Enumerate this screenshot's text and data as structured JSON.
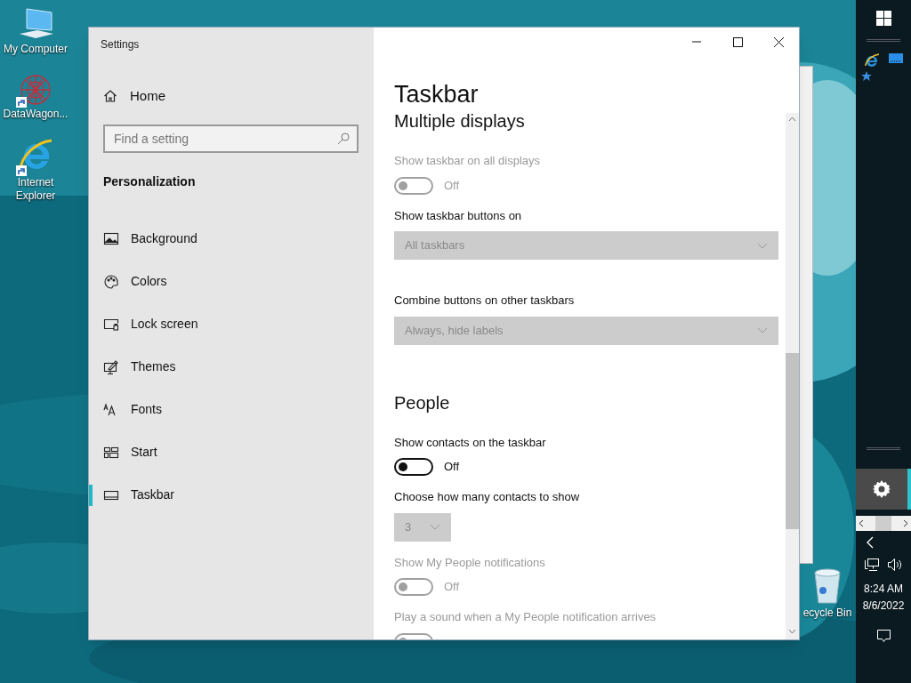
{
  "desktop_icons": [
    {
      "label": "My Computer",
      "kind": "computer",
      "shortcut": false
    },
    {
      "label": "DataWagon...",
      "kind": "network",
      "shortcut": true
    },
    {
      "label": "Internet Explorer",
      "kind": "browser",
      "shortcut": true
    }
  ],
  "recycle_bin": {
    "label": "ecycle Bin"
  },
  "window": {
    "title": "Settings"
  },
  "sidebar": {
    "home": "Home",
    "search": {
      "placeholder": "Find a setting"
    },
    "section": "Personalization",
    "items": [
      {
        "label": "Background",
        "selected": false
      },
      {
        "label": "Colors",
        "selected": false
      },
      {
        "label": "Lock screen",
        "selected": false
      },
      {
        "label": "Themes",
        "selected": false
      },
      {
        "label": "Fonts",
        "selected": false
      },
      {
        "label": "Start",
        "selected": false
      },
      {
        "label": "Taskbar",
        "selected": true
      }
    ]
  },
  "content": {
    "title": "Taskbar",
    "sections": [
      {
        "heading": "Multiple displays",
        "settings": [
          {
            "kind": "toggle",
            "label": "Show taskbar on all displays",
            "on": false,
            "disabled": true,
            "state_text": "Off"
          },
          {
            "kind": "dropdown",
            "label": "Show taskbar buttons on",
            "value": "All taskbars",
            "disabled": true
          },
          {
            "kind": "dropdown",
            "label": "Combine buttons on other taskbars",
            "value": "Always, hide labels",
            "disabled": true
          }
        ]
      },
      {
        "heading": "People",
        "settings": [
          {
            "kind": "toggle",
            "label": "Show contacts on the taskbar",
            "on": false,
            "disabled": false,
            "state_text": "Off"
          },
          {
            "kind": "small_dropdown",
            "label": "Choose how many contacts to show",
            "value": "3",
            "disabled": true
          },
          {
            "kind": "toggle",
            "label": "Show My People notifications",
            "on": false,
            "disabled": true,
            "state_text": "Off"
          },
          {
            "kind": "toggle",
            "label": "Play a sound when a My People notification arrives",
            "on": false,
            "disabled": true
          }
        ]
      }
    ]
  },
  "taskbar": {
    "time": "8:24 AM",
    "date": "8/6/2022"
  }
}
